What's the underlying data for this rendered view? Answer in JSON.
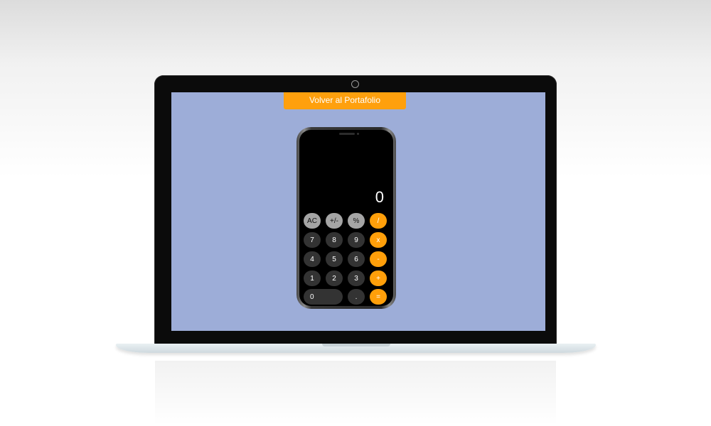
{
  "page": {
    "back_button_label": "Volver al Portafolio"
  },
  "calculator": {
    "display_value": "0",
    "keys": [
      {
        "label": "AC",
        "kind": "function"
      },
      {
        "label": "+/-",
        "kind": "function"
      },
      {
        "label": "%",
        "kind": "function"
      },
      {
        "label": "/",
        "kind": "operator"
      },
      {
        "label": "7",
        "kind": "digit"
      },
      {
        "label": "8",
        "kind": "digit"
      },
      {
        "label": "9",
        "kind": "digit"
      },
      {
        "label": "x",
        "kind": "operator"
      },
      {
        "label": "4",
        "kind": "digit"
      },
      {
        "label": "5",
        "kind": "digit"
      },
      {
        "label": "6",
        "kind": "digit"
      },
      {
        "label": "-",
        "kind": "operator"
      },
      {
        "label": "1",
        "kind": "digit"
      },
      {
        "label": "2",
        "kind": "digit"
      },
      {
        "label": "3",
        "kind": "digit"
      },
      {
        "label": "+",
        "kind": "operator"
      },
      {
        "label": "0",
        "kind": "digit"
      },
      {
        "label": ".",
        "kind": "digit"
      },
      {
        "label": "=",
        "kind": "operator"
      }
    ]
  },
  "colors": {
    "page_background": "#9dadd8",
    "accent_orange": "#ff9f0a",
    "function_key_gray": "#a5a5a5",
    "digit_key_dark": "#333333"
  }
}
